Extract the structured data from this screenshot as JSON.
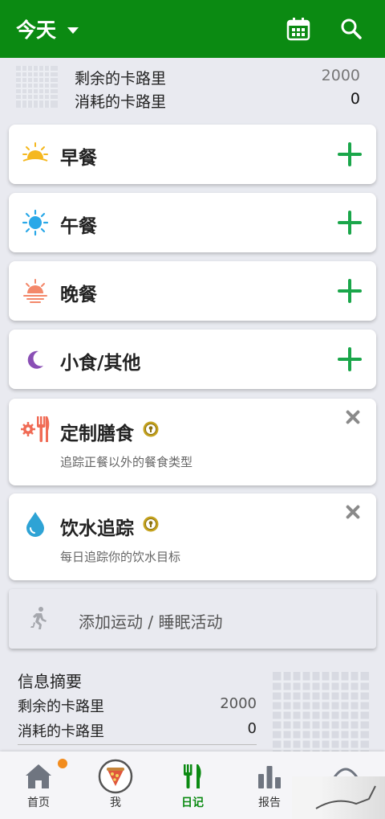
{
  "header": {
    "date_label": "今天",
    "calendar_icon": "calendar-icon",
    "search_icon": "search-icon",
    "background": "#0b8a12"
  },
  "summary_top": {
    "remaining_label": "剩余的卡路里",
    "remaining_value": "2000",
    "burned_label": "消耗的卡路里",
    "burned_value": "0"
  },
  "meals": [
    {
      "label": "早餐",
      "icon": "sunrise-icon"
    },
    {
      "label": "午餐",
      "icon": "sun-icon"
    },
    {
      "label": "晚餐",
      "icon": "sunset-icon"
    },
    {
      "label": "小食/其他",
      "icon": "moon-icon"
    }
  ],
  "promos": [
    {
      "label": "定制膳食",
      "desc": "追踪正餐以外的餐食类型",
      "icon": "custom-meal-icon"
    },
    {
      "label": "饮水追踪",
      "desc": "每日追踪你的饮水目标",
      "icon": "water-drop-icon"
    }
  ],
  "exercise": {
    "label": "添加运动 / 睡眠活动"
  },
  "info": {
    "title": "信息摘要",
    "remaining_label": "剩余的卡路里",
    "remaining_value": "2000",
    "burned_label": "消耗的卡路里",
    "burned_value": "0"
  },
  "nav": [
    {
      "label": "首页",
      "icon": "home-icon"
    },
    {
      "label": "我",
      "icon": "profile-avatar-icon"
    },
    {
      "label": "日记",
      "icon": "fork-knife-icon",
      "active": true
    },
    {
      "label": "报告",
      "icon": "bar-chart-icon"
    }
  ],
  "colors": {
    "accent_green": "#1aa64a",
    "header_green": "#0b8a12",
    "notification_dot": "#f28c1e"
  }
}
